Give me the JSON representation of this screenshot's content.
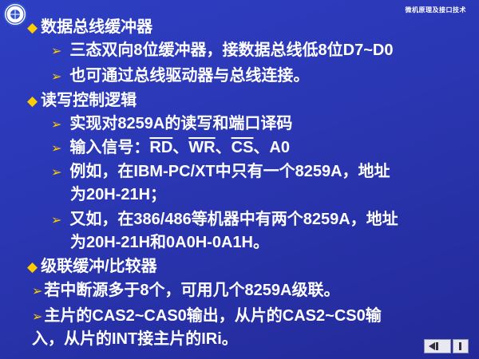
{
  "header": {
    "title": "微机原理及接口技术"
  },
  "logo": {
    "icon": "university-seal-icon"
  },
  "bullets": [
    {
      "text": "数据总线缓冲器"
    },
    {
      "text": "三态双向8位缓冲器，接数据总线低8位D7~D0"
    },
    {
      "text": "也可通过总线驱动器与总线连接。"
    },
    {
      "text": "读写控制逻辑"
    },
    {
      "text": "实现对8259A的读写和端口译码"
    },
    {
      "prefix": "输入信号：",
      "rd": "RD",
      "sep1": "、",
      "wr": "WR",
      "sep2": "、",
      "cs": "CS",
      "tail": "、A0"
    },
    {
      "text": "例如，在IBM-PC/XT中只有一个8259A，地址",
      "cont": "为20H-21H；"
    },
    {
      "text": "又如，在386/486等机器中有两个8259A，地址",
      "cont": "为20H-21H和0A0H-0A1H。"
    },
    {
      "text": "级联缓冲/比较器"
    },
    {
      "text": "若中断源多于8个，可用几个8259A级联。"
    },
    {
      "text": "主片的CAS2~CAS0输出，从片的CAS2~CS0输",
      "cont": "入，从片的INT接主片的IRi。"
    }
  ],
  "nav": {
    "prev_icon": "previous-slide-icon",
    "next_icon": "next-slide-icon"
  }
}
